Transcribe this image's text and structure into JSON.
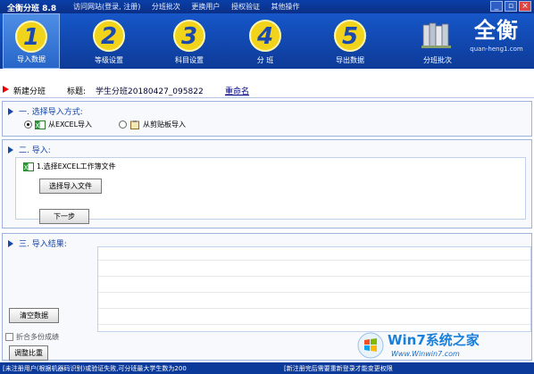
{
  "window": {
    "title": "全衡分班 8.8",
    "menu": [
      "访问网站(登录, 注册)",
      "分班批次",
      "更换用户",
      "授权验证",
      "其他操作"
    ]
  },
  "toolbar": {
    "items": [
      {
        "num": "1",
        "label": "导入数据",
        "active": true
      },
      {
        "num": "2",
        "label": "等级设置",
        "active": false
      },
      {
        "num": "3",
        "label": "科目设置",
        "active": false
      },
      {
        "num": "4",
        "label": "分  班",
        "active": false
      },
      {
        "num": "5",
        "label": "导出数据",
        "active": false
      }
    ],
    "batch_label": "分班批次",
    "logo_url": "quan-heng1.com"
  },
  "info": {
    "new_label": "新建分班",
    "name_label": "标题:",
    "name_value": "学生分班20180427_095822",
    "rename_label": "重命名"
  },
  "section1": {
    "heading": "一. 选择导入方式:",
    "option_excel": "从EXCEL导入",
    "option_clipboard": "从剪贴板导入",
    "selected": "excel"
  },
  "section2": {
    "heading": "二. 导入:",
    "file_prompt": "1.选择EXCEL工作簿文件",
    "choose_button": "选择导入文件",
    "next_button": "下一步"
  },
  "section3": {
    "heading": "三. 导入结果:",
    "clear_button": "清空数据",
    "merge_checkbox": "折合多份成绩",
    "merge_checked": false,
    "adjust_button": "调整比重"
  },
  "status": {
    "left": "[未注册用户(根据机器码识别)或验证失败,可分班最大学生数为200",
    "right": "[新注册完后需要重新登录才能变更权限"
  },
  "watermark": {
    "text": "Win7系统之家",
    "url": "Www.Winwin7.com"
  },
  "colors": {
    "titlebar": "#0a3fa8",
    "toolbar": "#1657c9",
    "accent": "#1847a8",
    "icon_yellow": "#f2d31c",
    "statusbar": "#0c3a9a"
  }
}
